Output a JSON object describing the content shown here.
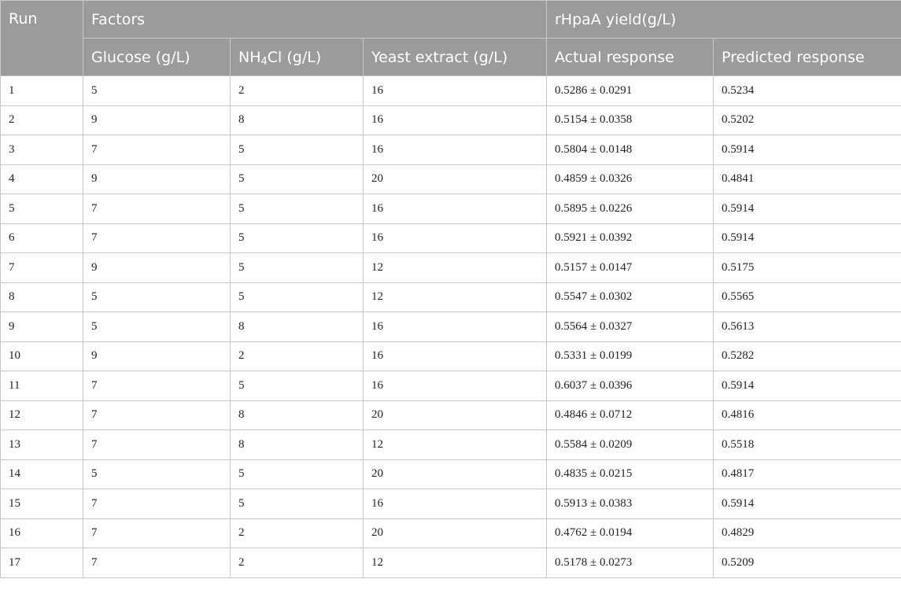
{
  "header": {
    "run": "Run",
    "factors": "Factors",
    "yield": "rHpaA yield(g/L)",
    "glucose": "Glucose (g/L)",
    "nh4cl_prefix": "NH",
    "nh4cl_sub": "4",
    "nh4cl_suffix": "Cl (g/L)",
    "yeast": "Yeast extract (g/L)",
    "actual": "Actual response",
    "predicted": "Predicted response"
  },
  "rows": [
    {
      "run": "1",
      "glucose": "5",
      "nh4cl": "2",
      "yeast": "16",
      "actual": "0.5286 ± 0.0291",
      "predicted": "0.5234"
    },
    {
      "run": "2",
      "glucose": "9",
      "nh4cl": "8",
      "yeast": "16",
      "actual": "0.5154 ± 0.0358",
      "predicted": "0.5202"
    },
    {
      "run": "3",
      "glucose": "7",
      "nh4cl": "5",
      "yeast": "16",
      "actual": "0.5804 ± 0.0148",
      "predicted": "0.5914"
    },
    {
      "run": "4",
      "glucose": "9",
      "nh4cl": "5",
      "yeast": "20",
      "actual": "0.4859 ± 0.0326",
      "predicted": "0.4841"
    },
    {
      "run": "5",
      "glucose": "7",
      "nh4cl": "5",
      "yeast": "16",
      "actual": "0.5895 ± 0.0226",
      "predicted": "0.5914"
    },
    {
      "run": "6",
      "glucose": "7",
      "nh4cl": "5",
      "yeast": "16",
      "actual": "0.5921 ± 0.0392",
      "predicted": "0.5914"
    },
    {
      "run": "7",
      "glucose": "9",
      "nh4cl": "5",
      "yeast": "12",
      "actual": "0.5157 ± 0.0147",
      "predicted": "0.5175"
    },
    {
      "run": "8",
      "glucose": "5",
      "nh4cl": "5",
      "yeast": "12",
      "actual": "0.5547 ± 0.0302",
      "predicted": "0.5565"
    },
    {
      "run": "9",
      "glucose": "5",
      "nh4cl": "8",
      "yeast": "16",
      "actual": "0.5564 ± 0.0327",
      "predicted": "0.5613"
    },
    {
      "run": "10",
      "glucose": "9",
      "nh4cl": "2",
      "yeast": "16",
      "actual": "0.5331 ± 0.0199",
      "predicted": "0.5282"
    },
    {
      "run": "11",
      "glucose": "7",
      "nh4cl": "5",
      "yeast": "16",
      "actual": "0.6037 ± 0.0396",
      "predicted": "0.5914"
    },
    {
      "run": "12",
      "glucose": "7",
      "nh4cl": "8",
      "yeast": "20",
      "actual": "0.4846 ± 0.0712",
      "predicted": "0.4816"
    },
    {
      "run": "13",
      "glucose": "7",
      "nh4cl": "8",
      "yeast": "12",
      "actual": "0.5584 ± 0.0209",
      "predicted": "0.5518"
    },
    {
      "run": "14",
      "glucose": "5",
      "nh4cl": "5",
      "yeast": "20",
      "actual": "0.4835 ± 0.0215",
      "predicted": "0.4817"
    },
    {
      "run": "15",
      "glucose": "7",
      "nh4cl": "5",
      "yeast": "16",
      "actual": "0.5913 ± 0.0383",
      "predicted": "0.5914"
    },
    {
      "run": "16",
      "glucose": "7",
      "nh4cl": "2",
      "yeast": "20",
      "actual": "0.4762 ± 0.0194",
      "predicted": "0.4829"
    },
    {
      "run": "17",
      "glucose": "7",
      "nh4cl": "2",
      "yeast": "12",
      "actual": "0.5178 ± 0.0273",
      "predicted": "0.5209"
    }
  ]
}
